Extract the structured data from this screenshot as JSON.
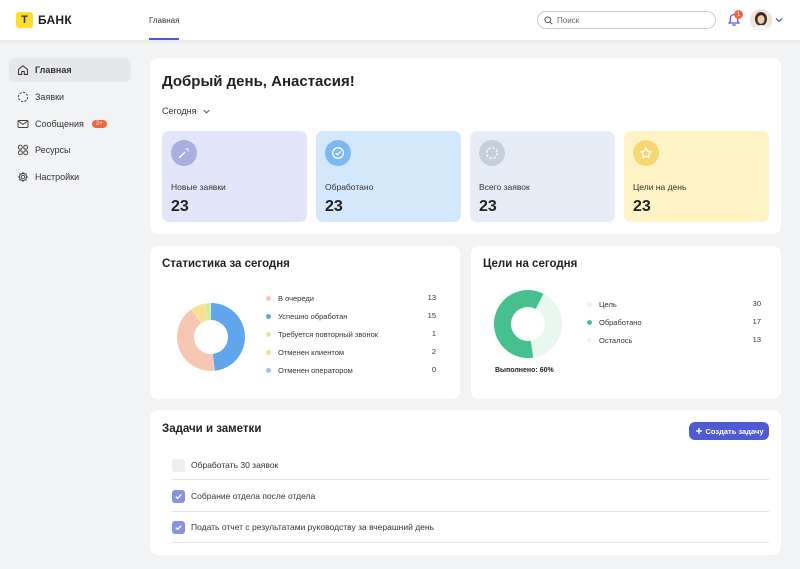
{
  "brand": {
    "mark": "Т",
    "name": "БАНК"
  },
  "topbar": {
    "tab": "Главная",
    "search_placeholder": "Поиск",
    "notifications_count": "1"
  },
  "sidebar": {
    "items": [
      {
        "label": "Главная",
        "icon": "home-icon",
        "active": true
      },
      {
        "label": "Заявки",
        "icon": "dashed-circle-icon"
      },
      {
        "label": "Сообщения",
        "icon": "envelope-icon",
        "badge": "2+"
      },
      {
        "label": "Ресурсы",
        "icon": "grid-icon"
      },
      {
        "label": "Настройки",
        "icon": "gear-icon"
      }
    ]
  },
  "greeting": {
    "title": "Добрый день, Анастасия!",
    "period": "Сегодня"
  },
  "stats": [
    {
      "label": "Новые заявки",
      "value": "23",
      "bg": "#e3e5f8",
      "circle": "#a9aee0",
      "icon": "new-requests-icon"
    },
    {
      "label": "Обработано",
      "value": "23",
      "bg": "#d4e8fc",
      "circle": "#7fb7ef",
      "icon": "check-circle-icon"
    },
    {
      "label": "Всего заявок",
      "value": "23",
      "bg": "#e6edf6",
      "circle": "#c6cfdc",
      "icon": "loader-icon"
    },
    {
      "label": "Цели на день",
      "value": "23",
      "bg": "#fdf3c4",
      "circle": "#f5d774",
      "icon": "star-icon"
    }
  ],
  "stats_today": {
    "title": "Статистика за сегодня",
    "items": [
      {
        "label": "В очереди",
        "value": 13,
        "color": "#f8c7b3"
      },
      {
        "label": "Успешно обработан",
        "value": 15,
        "color": "#5fa6ec"
      },
      {
        "label": "Требуется повторный звонок",
        "value": 1,
        "color": "#d5ec9c"
      },
      {
        "label": "Отменен клиентом",
        "value": 2,
        "color": "#f8e08c"
      },
      {
        "label": "Отменен оператором",
        "value": 0,
        "color": "#9cc4f0"
      }
    ]
  },
  "goals_today": {
    "title": "Цели на сегодня",
    "items": [
      {
        "label": "Цель",
        "value": 30,
        "color": "#edf0f3"
      },
      {
        "label": "Обработано",
        "value": 17,
        "color": "#46c08f"
      },
      {
        "label": "Осталось",
        "value": 13,
        "color": "#e9f7f1"
      }
    ],
    "progress_fraction": 0.6,
    "done_text": "Выполнено: 60%"
  },
  "tasks": {
    "title": "Задачи и заметки",
    "create_label": "Создать задачу",
    "items": [
      {
        "text": "Обработать 30 заявок",
        "done": false
      },
      {
        "text": "Собрание отдела после отдела",
        "done": true
      },
      {
        "text": "Подать отчет с результатами руководству за вчерашний день",
        "done": true
      }
    ]
  },
  "colors": {
    "accent": "#4f5bd5",
    "badge": "#f2663c",
    "brand": "#ffdd2d"
  }
}
